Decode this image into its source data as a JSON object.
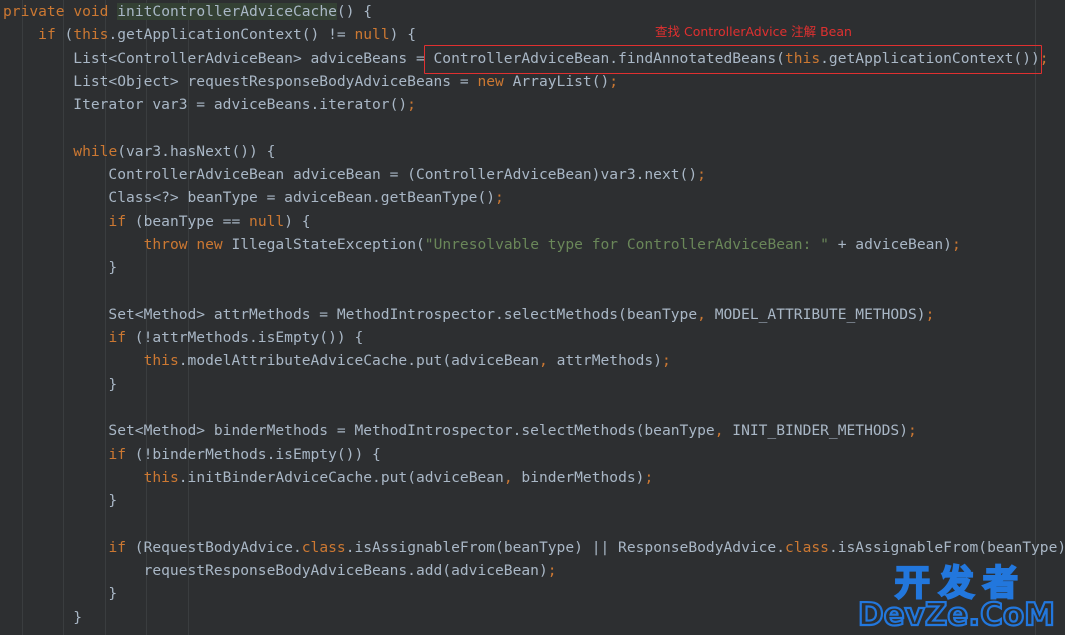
{
  "editor": {
    "background_color": "#2d2f31",
    "default_text_color": "#a9b7c6",
    "keyword_color": "#cc7832",
    "string_color": "#6a8759",
    "constant_color": "#9876aa",
    "highlight_color": "#344134",
    "annotation_color": "#e03030",
    "watermark_color": "#2277dd"
  },
  "code_lines": [
    {
      "id": "line-1",
      "indent": 0,
      "text": "private void initControllerAdviceCache() {"
    },
    {
      "id": "line-2",
      "indent": 1,
      "text": "if (this.getApplicationContext() != null) {"
    },
    {
      "id": "line-3",
      "indent": 2,
      "text": "List<ControllerAdviceBean> adviceBeans = ControllerAdviceBean.findAnnotatedBeans(this.getApplicationContext());"
    },
    {
      "id": "line-4",
      "indent": 2,
      "text": "List<Object> requestResponseBodyAdviceBeans = new ArrayList();"
    },
    {
      "id": "line-5",
      "indent": 2,
      "text": "Iterator var3 = adviceBeans.iterator();"
    },
    {
      "id": "line-6",
      "indent": 0,
      "text": ""
    },
    {
      "id": "line-7",
      "indent": 2,
      "text": "while(var3.hasNext()) {"
    },
    {
      "id": "line-8",
      "indent": 3,
      "text": "ControllerAdviceBean adviceBean = (ControllerAdviceBean)var3.next();"
    },
    {
      "id": "line-9",
      "indent": 3,
      "text": "Class<?> beanType = adviceBean.getBeanType();"
    },
    {
      "id": "line-10",
      "indent": 3,
      "text": "if (beanType == null) {"
    },
    {
      "id": "line-11",
      "indent": 4,
      "text": "throw new IllegalStateException(\"Unresolvable type for ControllerAdviceBean: \" + adviceBean);"
    },
    {
      "id": "line-12",
      "indent": 3,
      "text": "}"
    },
    {
      "id": "line-13",
      "indent": 0,
      "text": ""
    },
    {
      "id": "line-14",
      "indent": 3,
      "text": "Set<Method> attrMethods = MethodIntrospector.selectMethods(beanType, MODEL_ATTRIBUTE_METHODS);"
    },
    {
      "id": "line-15",
      "indent": 3,
      "text": "if (!attrMethods.isEmpty()) {"
    },
    {
      "id": "line-16",
      "indent": 4,
      "text": "this.modelAttributeAdviceCache.put(adviceBean, attrMethods);"
    },
    {
      "id": "line-17",
      "indent": 3,
      "text": "}"
    },
    {
      "id": "line-18",
      "indent": 0,
      "text": ""
    },
    {
      "id": "line-19",
      "indent": 3,
      "text": "Set<Method> binderMethods = MethodIntrospector.selectMethods(beanType, INIT_BINDER_METHODS);"
    },
    {
      "id": "line-20",
      "indent": 3,
      "text": "if (!binderMethods.isEmpty()) {"
    },
    {
      "id": "line-21",
      "indent": 4,
      "text": "this.initBinderAdviceCache.put(adviceBean, binderMethods);"
    },
    {
      "id": "line-22",
      "indent": 3,
      "text": "}"
    },
    {
      "id": "line-23",
      "indent": 0,
      "text": ""
    },
    {
      "id": "line-24",
      "indent": 3,
      "text": "if (RequestBodyAdvice.class.isAssignableFrom(beanType) || ResponseBodyAdvice.class.isAssignableFrom(beanType)) {"
    },
    {
      "id": "line-25",
      "indent": 4,
      "text": "requestResponseBodyAdviceBeans.add(adviceBean);"
    },
    {
      "id": "line-26",
      "indent": 3,
      "text": "}"
    },
    {
      "id": "line-27",
      "indent": 2,
      "text": "}"
    }
  ],
  "annotation": {
    "label": "查找 ControllerAdvice 注解 Bean",
    "highlighted_code": "ControllerAdviceBean.findAnnotatedBeans(this.getApplicationContext());"
  },
  "highlighted_identifier": "initControllerAdviceCache",
  "watermark": {
    "line1": "开发者",
    "line2": "DevZe.CoM"
  }
}
